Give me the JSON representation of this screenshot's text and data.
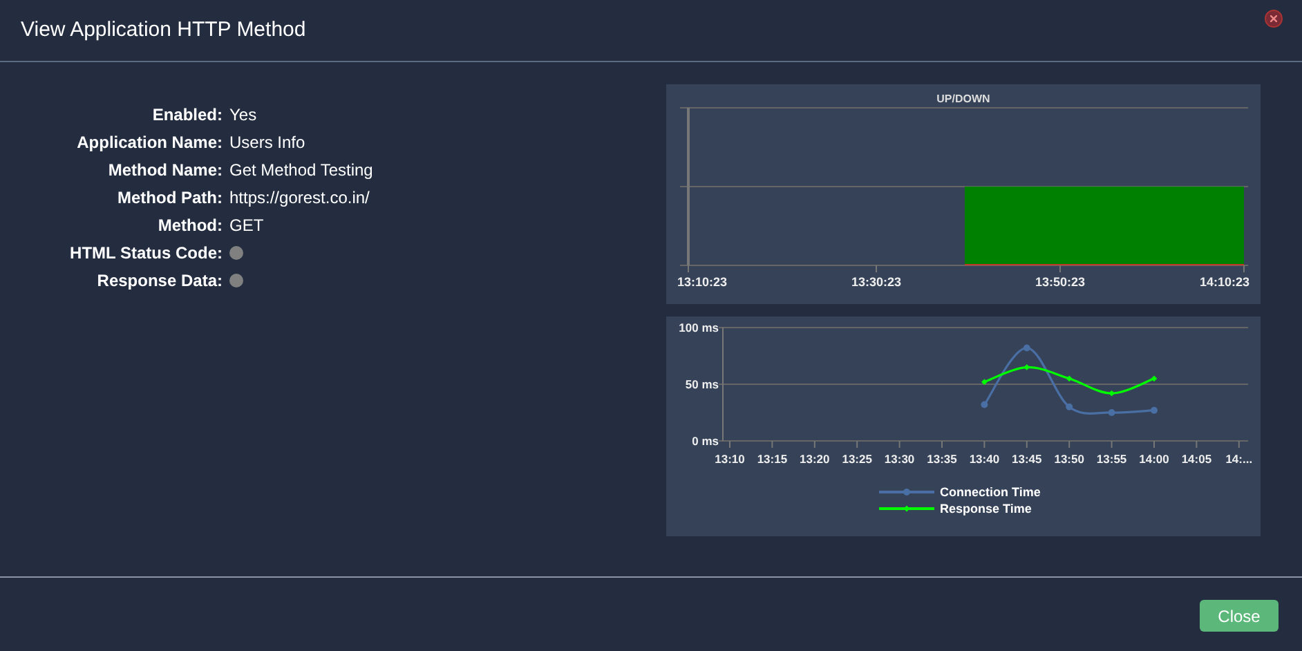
{
  "dialog": {
    "title": "View Application HTTP Method"
  },
  "fields": [
    {
      "label": "Enabled:",
      "kind": "text",
      "value": "Yes"
    },
    {
      "label": "Application Name:",
      "kind": "text",
      "value": "Users Info"
    },
    {
      "label": "Method Name:",
      "kind": "text",
      "value": "Get Method Testing"
    },
    {
      "label": "Method Path:",
      "kind": "text",
      "value": "https://gorest.co.in/"
    },
    {
      "label": "Method:",
      "kind": "text",
      "value": "GET"
    },
    {
      "label": "HTML Status Code:",
      "kind": "dot",
      "color": "#808080"
    },
    {
      "label": "Response Data:",
      "kind": "dot",
      "color": "#808080"
    }
  ],
  "uptime_chart": {
    "title": "UP/DOWN",
    "xticks": [
      "13:10:23",
      "13:30:23",
      "13:50:23",
      "14:10:23"
    ]
  },
  "response_chart": {
    "chart_data": {
      "type": "line",
      "categories": [
        "13:10",
        "13:15",
        "13:20",
        "13:25",
        "13:30",
        "13:35",
        "13:40",
        "13:45",
        "13:50",
        "13:55",
        "14:00",
        "14:05",
        "14:..."
      ],
      "ylim": [
        0,
        100
      ],
      "yticks": [
        {
          "value": 0,
          "label": "0 ms"
        },
        {
          "value": 50,
          "label": "50 ms"
        },
        {
          "value": 100,
          "label": "100 ms"
        }
      ],
      "legend": true,
      "series": [
        {
          "name": "Connection Time",
          "color": "#4a6fa5",
          "marker": "circle",
          "values": [
            null,
            null,
            null,
            null,
            null,
            null,
            32,
            82,
            30,
            25,
            27,
            null,
            null
          ]
        },
        {
          "name": "Response Time",
          "color": "#00ff00",
          "marker": "diamond",
          "values": [
            null,
            null,
            null,
            null,
            null,
            null,
            52,
            65,
            55,
            42,
            55,
            null,
            null
          ]
        }
      ]
    }
  },
  "buttons": [
    {
      "label": "Close"
    }
  ]
}
